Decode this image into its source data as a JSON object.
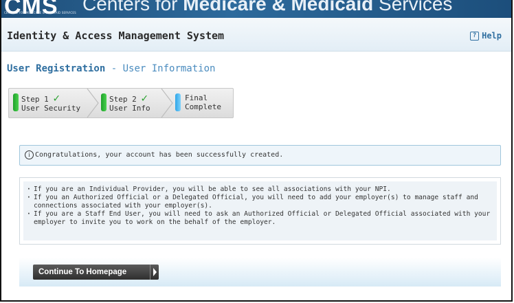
{
  "banner": {
    "logo_text": "CMS",
    "logo_subtext": "CENTERS FOR MEDICARE & MEDICAID SERVICES",
    "title_prefix": "Centers for ",
    "title_bold": "Medicare & Medicaid",
    "title_suffix": " Services"
  },
  "header": {
    "app_title": "Identity & Access Management System",
    "help_label": "Help",
    "help_icon": "?"
  },
  "page": {
    "title": "User Registration",
    "subtitle": " - User Information"
  },
  "steps": [
    {
      "line1": "Step 1",
      "line2": "User Security",
      "status": "complete",
      "check": "✓"
    },
    {
      "line1": "Step 2",
      "line2": "User Info",
      "status": "complete",
      "check": "✓"
    },
    {
      "line1": "Final",
      "line2": "Complete",
      "status": "current"
    }
  ],
  "message": {
    "icon": "i",
    "text": "Congratulations, your account has been successfully created."
  },
  "notes": [
    "If you are an Individual Provider, you will be able to see all associations with your NPI.",
    "If you an Authorized Official or a Delegated Official, you will need to add your employer(s) to manage staff and connections associated with your employer(s).",
    "If you are a Staff End User, you will need to ask an Authorized Official or Delegated Official associated with your employer to invite you to work on the behalf of the employer."
  ],
  "actions": {
    "continue_label": "Continue To Homepage"
  }
}
